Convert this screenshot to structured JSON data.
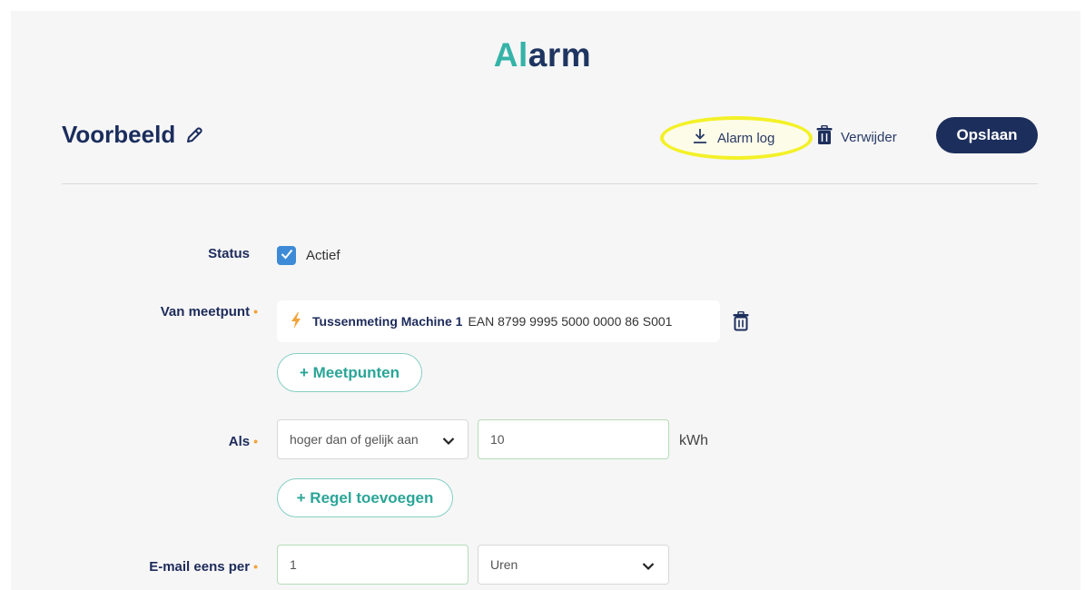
{
  "title": {
    "part1": "Al",
    "part2": "arm"
  },
  "alarm_name": "Voorbeeld",
  "toolbar": {
    "alarm_log_label": "Alarm log",
    "delete_label": "Verwijder",
    "save_label": "Opslaan"
  },
  "form": {
    "status": {
      "label": "Status",
      "checkbox_label": "Actief",
      "checked": true
    },
    "meter": {
      "label": "Van meetpunt",
      "required_mark": "•",
      "item_name": "Tussenmeting Machine 1",
      "item_ean": "EAN 8799 9995 5000 0000 86 S001",
      "add_button": "+ Meetpunten"
    },
    "condition": {
      "label": "Als",
      "required_mark": "•",
      "operator": "hoger dan of gelijk aan",
      "value": "10",
      "unit": "kWh",
      "add_rule_button": "+ Regel toevoegen"
    },
    "email": {
      "label": "E-mail eens per",
      "required_mark": "•",
      "value": "1",
      "period": "Uren"
    }
  },
  "colors": {
    "navy": "#1c2e5c",
    "teal": "#35b3a8",
    "highlight": "#f3f126",
    "checkbox": "#3d8bd6",
    "required": "#f2a33a"
  }
}
